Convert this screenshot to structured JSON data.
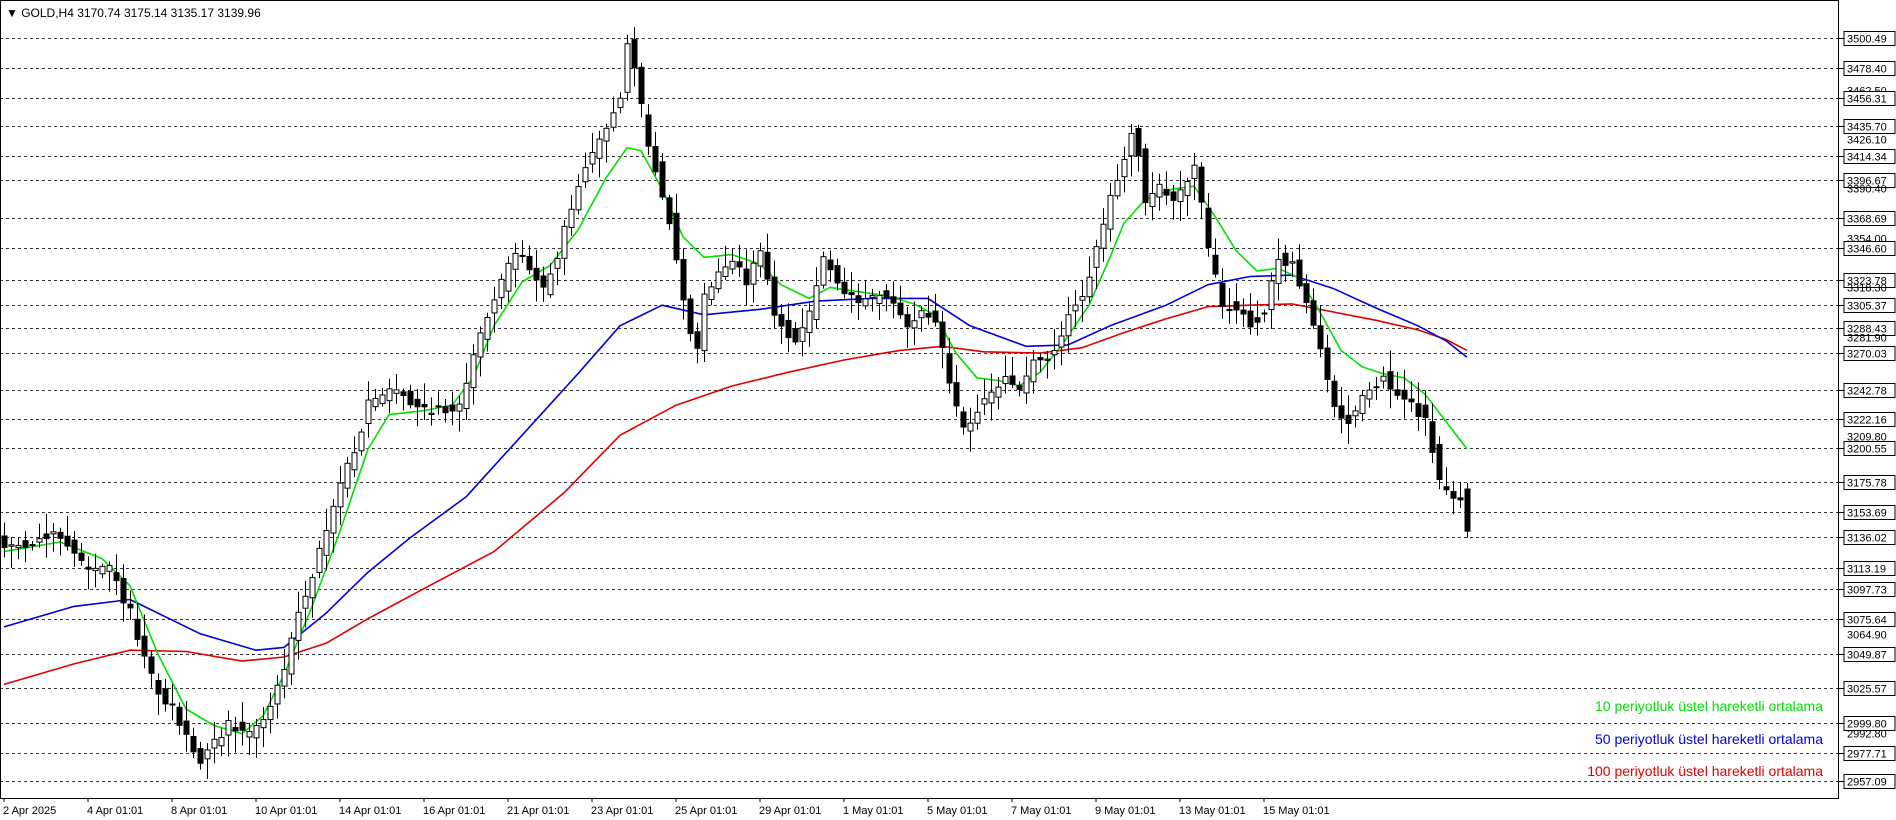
{
  "header": {
    "text": "▼ GOLD,H4  3170.74 3175.14 3135.17 3139.96"
  },
  "legend": [
    {
      "label": "10 periyotluk üstel hareketli ortalama",
      "color": "#00e000"
    },
    {
      "label": "50 periyotluk üstel hareketli ortalama",
      "color": "#0000e0"
    },
    {
      "label": "100 periyotluk üstel hareketli ortalama",
      "color": "#e00000"
    }
  ],
  "colors": {
    "bull": "#ffffff",
    "bear": "#000000",
    "grid": "#333333",
    "frame": "#000000"
  },
  "chart_data": {
    "type": "candlestick",
    "symbol": "GOLD",
    "timeframe": "H4",
    "ylim": [
      2945,
      3528
    ],
    "grid": "horizontal dashed at labeled levels",
    "legend_position": "bottom-right",
    "x_ticks": [
      "2 Apr 2025",
      "4 Apr 01:01",
      "8 Apr 01:01",
      "10 Apr 01:01",
      "14 Apr 01:01",
      "16 Apr 01:01",
      "21 Apr 01:01",
      "23 Apr 01:01",
      "25 Apr 01:01",
      "29 Apr 01:01",
      "1 May 01:01",
      "5 May 01:01",
      "7 May 01:01",
      "9 May 01:01",
      "13 May 01:01",
      "15 May 01:01"
    ],
    "price_labels": [
      {
        "value": 3500.49,
        "boxed": true
      },
      {
        "value": 3478.4,
        "boxed": true
      },
      {
        "value": 3462.5,
        "boxed": false
      },
      {
        "value": 3456.31,
        "boxed": true
      },
      {
        "value": 3435.7,
        "boxed": true
      },
      {
        "value": 3426.1,
        "boxed": false
      },
      {
        "value": 3414.34,
        "boxed": true
      },
      {
        "value": 3396.67,
        "boxed": true
      },
      {
        "value": 3390.4,
        "boxed": false
      },
      {
        "value": 3368.69,
        "boxed": true
      },
      {
        "value": 3354.0,
        "boxed": false
      },
      {
        "value": 3346.6,
        "boxed": true
      },
      {
        "value": 3323.78,
        "boxed": true
      },
      {
        "value": 3318.3,
        "boxed": false
      },
      {
        "value": 3305.37,
        "boxed": true
      },
      {
        "value": 3288.43,
        "boxed": true
      },
      {
        "value": 3281.9,
        "boxed": false
      },
      {
        "value": 3270.03,
        "boxed": true
      },
      {
        "value": 3242.78,
        "boxed": true
      },
      {
        "value": 3222.16,
        "boxed": true
      },
      {
        "value": 3209.8,
        "boxed": false
      },
      {
        "value": 3200.55,
        "boxed": true
      },
      {
        "value": 3175.78,
        "boxed": true
      },
      {
        "value": 3153.69,
        "boxed": true
      },
      {
        "value": 3136.02,
        "boxed": true
      },
      {
        "value": 3113.19,
        "boxed": true
      },
      {
        "value": 3097.73,
        "boxed": true
      },
      {
        "value": 3075.64,
        "boxed": true
      },
      {
        "value": 3064.9,
        "boxed": false
      },
      {
        "value": 3049.87,
        "boxed": true
      },
      {
        "value": 3025.57,
        "boxed": true
      },
      {
        "value": 2999.8,
        "boxed": true
      },
      {
        "value": 2992.8,
        "boxed": false
      },
      {
        "value": 2977.71,
        "boxed": true
      },
      {
        "value": 2957.09,
        "boxed": true
      }
    ],
    "close_anchors": [
      [
        0,
        3128
      ],
      [
        4,
        3132
      ],
      [
        8,
        3137
      ],
      [
        10,
        3125
      ],
      [
        12,
        3110
      ],
      [
        15,
        3112
      ],
      [
        18,
        3080
      ],
      [
        20,
        3045
      ],
      [
        22,
        3020
      ],
      [
        24,
        3010
      ],
      [
        26,
        2990
      ],
      [
        28,
        2972
      ],
      [
        30,
        2985
      ],
      [
        32,
        2999
      ],
      [
        35,
        2992
      ],
      [
        38,
        3010
      ],
      [
        40,
        3040
      ],
      [
        42,
        3080
      ],
      [
        44,
        3110
      ],
      [
        46,
        3140
      ],
      [
        48,
        3175
      ],
      [
        50,
        3200
      ],
      [
        52,
        3232
      ],
      [
        56,
        3245
      ],
      [
        58,
        3235
      ],
      [
        60,
        3230
      ],
      [
        63,
        3228
      ],
      [
        65,
        3233
      ],
      [
        67,
        3265
      ],
      [
        69,
        3300
      ],
      [
        71,
        3320
      ],
      [
        73,
        3345
      ],
      [
        75,
        3332
      ],
      [
        77,
        3316
      ],
      [
        79,
        3340
      ],
      [
        81,
        3378
      ],
      [
        83,
        3405
      ],
      [
        85,
        3424
      ],
      [
        87,
        3448
      ],
      [
        88,
        3460
      ],
      [
        89,
        3500
      ],
      [
        90,
        3478
      ],
      [
        92,
        3420
      ],
      [
        93,
        3405
      ],
      [
        95,
        3368
      ],
      [
        97,
        3305
      ],
      [
        99,
        3270
      ],
      [
        100,
        3314
      ],
      [
        102,
        3330
      ],
      [
        104,
        3340
      ],
      [
        106,
        3322
      ],
      [
        108,
        3348
      ],
      [
        110,
        3296
      ],
      [
        113,
        3280
      ],
      [
        115,
        3298
      ],
      [
        117,
        3340
      ],
      [
        119,
        3318
      ],
      [
        121,
        3310
      ],
      [
        123,
        3306
      ],
      [
        125,
        3312
      ],
      [
        127,
        3306
      ],
      [
        129,
        3290
      ],
      [
        131,
        3302
      ],
      [
        133,
        3294
      ],
      [
        135,
        3248
      ],
      [
        137,
        3216
      ],
      [
        139,
        3228
      ],
      [
        141,
        3238
      ],
      [
        143,
        3252
      ],
      [
        145,
        3244
      ],
      [
        147,
        3262
      ],
      [
        150,
        3270
      ],
      [
        152,
        3296
      ],
      [
        154,
        3312
      ],
      [
        156,
        3345
      ],
      [
        158,
        3382
      ],
      [
        160,
        3410
      ],
      [
        161,
        3430
      ],
      [
        162,
        3418
      ],
      [
        163,
        3380
      ],
      [
        165,
        3390
      ],
      [
        167,
        3382
      ],
      [
        169,
        3398
      ],
      [
        170,
        3408
      ],
      [
        172,
        3345
      ],
      [
        174,
        3305
      ],
      [
        176,
        3302
      ],
      [
        178,
        3292
      ],
      [
        180,
        3300
      ],
      [
        182,
        3338
      ],
      [
        184,
        3335
      ],
      [
        186,
        3310
      ],
      [
        188,
        3270
      ],
      [
        190,
        3230
      ],
      [
        192,
        3220
      ],
      [
        194,
        3240
      ],
      [
        197,
        3252
      ],
      [
        199,
        3238
      ],
      [
        201,
        3232
      ],
      [
        203,
        3222
      ],
      [
        205,
        3175
      ],
      [
        207,
        3168
      ],
      [
        208,
        3163
      ],
      [
        209,
        3139.96
      ]
    ],
    "ema10": [
      [
        0,
        3125
      ],
      [
        8,
        3132
      ],
      [
        14,
        3120
      ],
      [
        18,
        3100
      ],
      [
        22,
        3050
      ],
      [
        26,
        3010
      ],
      [
        30,
        2998
      ],
      [
        34,
        2992
      ],
      [
        37,
        3005
      ],
      [
        40,
        3035
      ],
      [
        44,
        3085
      ],
      [
        48,
        3140
      ],
      [
        52,
        3200
      ],
      [
        55,
        3225
      ],
      [
        60,
        3228
      ],
      [
        64,
        3232
      ],
      [
        67,
        3252
      ],
      [
        70,
        3290
      ],
      [
        74,
        3322
      ],
      [
        78,
        3334
      ],
      [
        82,
        3360
      ],
      [
        86,
        3398
      ],
      [
        89,
        3420
      ],
      [
        91,
        3418
      ],
      [
        94,
        3390
      ],
      [
        97,
        3355
      ],
      [
        100,
        3340
      ],
      [
        104,
        3342
      ],
      [
        108,
        3335
      ],
      [
        111,
        3320
      ],
      [
        115,
        3310
      ],
      [
        118,
        3318
      ],
      [
        122,
        3315
      ],
      [
        126,
        3312
      ],
      [
        130,
        3306
      ],
      [
        133,
        3298
      ],
      [
        136,
        3270
      ],
      [
        139,
        3252
      ],
      [
        142,
        3250
      ],
      [
        145,
        3246
      ],
      [
        148,
        3256
      ],
      [
        151,
        3275
      ],
      [
        155,
        3305
      ],
      [
        158,
        3340
      ],
      [
        160,
        3365
      ],
      [
        163,
        3382
      ],
      [
        167,
        3390
      ],
      [
        170,
        3392
      ],
      [
        173,
        3370
      ],
      [
        176,
        3345
      ],
      [
        179,
        3330
      ],
      [
        182,
        3332
      ],
      [
        185,
        3325
      ],
      [
        188,
        3300
      ],
      [
        191,
        3272
      ],
      [
        194,
        3260
      ],
      [
        197,
        3255
      ],
      [
        200,
        3252
      ],
      [
        203,
        3240
      ],
      [
        206,
        3220
      ],
      [
        209,
        3200
      ]
    ],
    "ema50": [
      [
        0,
        3070
      ],
      [
        10,
        3085
      ],
      [
        18,
        3090
      ],
      [
        28,
        3065
      ],
      [
        36,
        3053
      ],
      [
        40,
        3055
      ],
      [
        46,
        3080
      ],
      [
        52,
        3110
      ],
      [
        58,
        3135
      ],
      [
        66,
        3165
      ],
      [
        74,
        3210
      ],
      [
        82,
        3255
      ],
      [
        88,
        3290
      ],
      [
        94,
        3305
      ],
      [
        100,
        3298
      ],
      [
        108,
        3302
      ],
      [
        116,
        3308
      ],
      [
        124,
        3310
      ],
      [
        132,
        3310
      ],
      [
        138,
        3290
      ],
      [
        146,
        3275
      ],
      [
        152,
        3276
      ],
      [
        158,
        3290
      ],
      [
        166,
        3305
      ],
      [
        172,
        3320
      ],
      [
        178,
        3326
      ],
      [
        184,
        3327
      ],
      [
        190,
        3317
      ],
      [
        196,
        3303
      ],
      [
        202,
        3290
      ],
      [
        206,
        3279
      ],
      [
        209,
        3267
      ]
    ],
    "ema100": [
      [
        0,
        3028
      ],
      [
        10,
        3043
      ],
      [
        18,
        3053
      ],
      [
        26,
        3052
      ],
      [
        34,
        3045
      ],
      [
        40,
        3048
      ],
      [
        46,
        3058
      ],
      [
        52,
        3076
      ],
      [
        60,
        3098
      ],
      [
        70,
        3125
      ],
      [
        80,
        3168
      ],
      [
        88,
        3210
      ],
      [
        96,
        3232
      ],
      [
        104,
        3246
      ],
      [
        112,
        3256
      ],
      [
        120,
        3265
      ],
      [
        128,
        3272
      ],
      [
        134,
        3275
      ],
      [
        140,
        3271
      ],
      [
        148,
        3270
      ],
      [
        154,
        3274
      ],
      [
        160,
        3285
      ],
      [
        166,
        3295
      ],
      [
        172,
        3304
      ],
      [
        178,
        3305
      ],
      [
        184,
        3306
      ],
      [
        190,
        3300
      ],
      [
        196,
        3294
      ],
      [
        202,
        3287
      ],
      [
        206,
        3280
      ],
      [
        209,
        3272
      ]
    ]
  }
}
